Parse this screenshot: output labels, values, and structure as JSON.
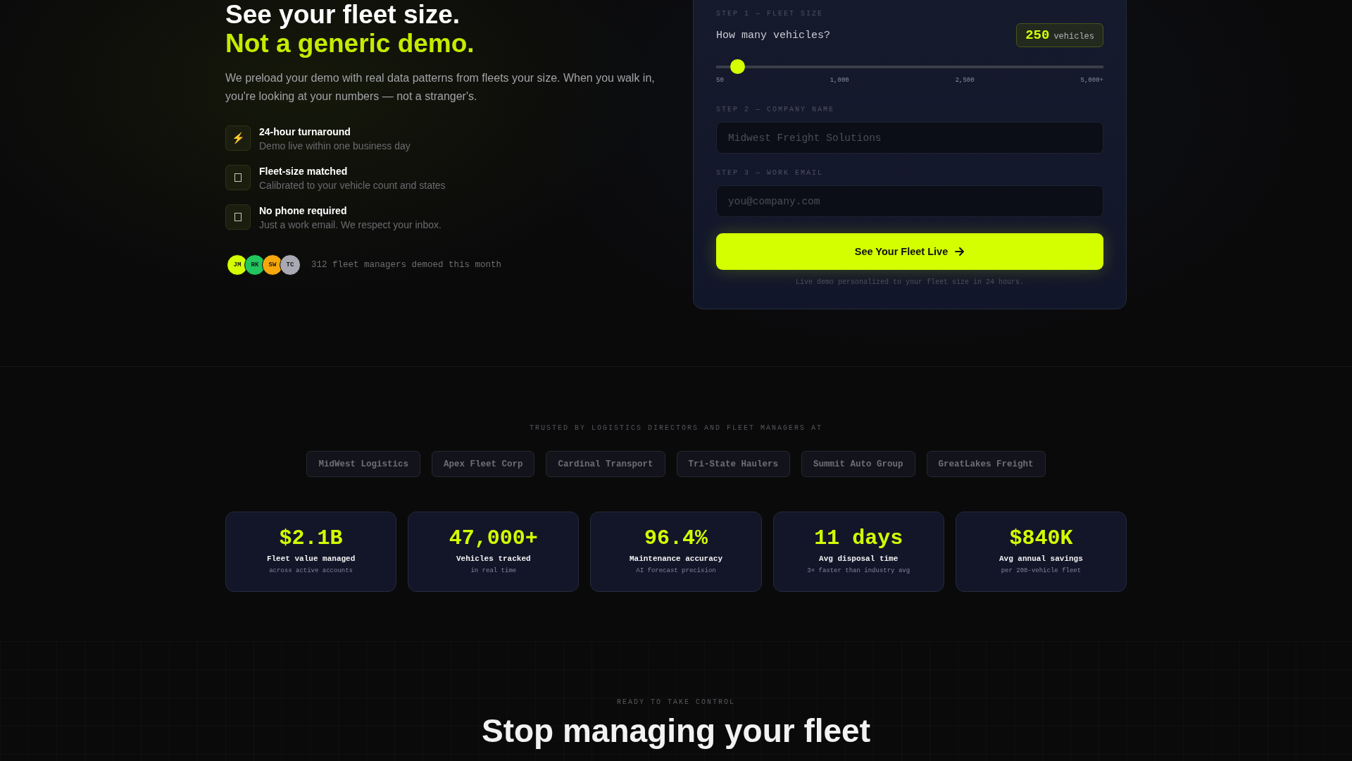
{
  "hero": {
    "headline": "See your fleet size.",
    "headline_accent": "Not a generic demo.",
    "intro": "We preload your demo with real data patterns from fleets your size. When you walk in, you're looking at your numbers — not a stranger's.",
    "features": [
      {
        "kind": "glyph",
        "glyph": "⚡",
        "title": "24-hour turnaround",
        "text": "Demo live within one business day"
      },
      {
        "kind": "missing-glyph",
        "title": "Fleet-size matched",
        "text": "Calibrated to your vehicle count and states"
      },
      {
        "kind": "missing-glyph",
        "title": "No phone required",
        "text": "Just a work email. We respect your inbox."
      }
    ],
    "avatars": [
      {
        "initials": "JM",
        "color": "#d4ff00"
      },
      {
        "initials": "RK",
        "color": "#22c55e"
      },
      {
        "initials": "SW",
        "color": "#f5a70b"
      },
      {
        "initials": "TC",
        "color": "#a9a9b4"
      }
    ],
    "social_proof": "312 fleet managers demoed this month"
  },
  "form": {
    "step1_label": "STEP 1 — FLEET SIZE",
    "question": "How many vehicles?",
    "count": "250",
    "count_unit": "vehicles",
    "slider": {
      "level": 0.055,
      "ticks": [
        "50",
        "1,000",
        "2,500",
        "5,000+"
      ]
    },
    "step2_label": "STEP 2 — COMPANY NAME",
    "company": {
      "placeholder": "Midwest Freight Solutions"
    },
    "step3_label": "STEP 3 — WORK EMAIL",
    "email": {
      "placeholder": "you@company.com"
    },
    "submit": "See Your Fleet Live",
    "note": "Live demo personalized to your fleet size in 24 hours."
  },
  "trusted": {
    "label": "TRUSTED BY LOGISTICS DIRECTORS AND FLEET MANAGERS AT",
    "companies": [
      "MidWest Logistics",
      "Apex Fleet Corp",
      "Cardinal Transport",
      "Tri-State Haulers",
      "Summit Auto Group",
      "GreatLakes Freight"
    ]
  },
  "stats": [
    {
      "value": "$2.1B",
      "label": "Fleet value managed",
      "sub": "across active accounts"
    },
    {
      "value": "47,000+",
      "label": "Vehicles tracked",
      "sub": "in real time"
    },
    {
      "value": "96.4%",
      "label": "Maintenance accuracy",
      "sub": "AI forecast precision"
    },
    {
      "value": "11 days",
      "label": "Avg disposal time",
      "sub": "3× faster than industry avg"
    },
    {
      "value": "$840K",
      "label": "Avg annual savings",
      "sub": "per 200-vehicle fleet"
    }
  ],
  "cta": {
    "eyebrow": "READY TO TAKE CONTROL",
    "heading": "Stop managing your fleet"
  }
}
